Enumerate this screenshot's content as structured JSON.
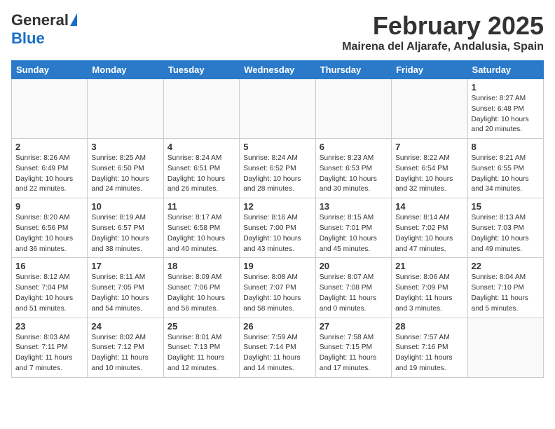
{
  "header": {
    "logo_general": "General",
    "logo_blue": "Blue",
    "month": "February 2025",
    "location": "Mairena del Aljarafe, Andalusia, Spain"
  },
  "weekdays": [
    "Sunday",
    "Monday",
    "Tuesday",
    "Wednesday",
    "Thursday",
    "Friday",
    "Saturday"
  ],
  "weeks": [
    [
      {
        "day": "",
        "info": ""
      },
      {
        "day": "",
        "info": ""
      },
      {
        "day": "",
        "info": ""
      },
      {
        "day": "",
        "info": ""
      },
      {
        "day": "",
        "info": ""
      },
      {
        "day": "",
        "info": ""
      },
      {
        "day": "1",
        "info": "Sunrise: 8:27 AM\nSunset: 6:48 PM\nDaylight: 10 hours\nand 20 minutes."
      }
    ],
    [
      {
        "day": "2",
        "info": "Sunrise: 8:26 AM\nSunset: 6:49 PM\nDaylight: 10 hours\nand 22 minutes."
      },
      {
        "day": "3",
        "info": "Sunrise: 8:25 AM\nSunset: 6:50 PM\nDaylight: 10 hours\nand 24 minutes."
      },
      {
        "day": "4",
        "info": "Sunrise: 8:24 AM\nSunset: 6:51 PM\nDaylight: 10 hours\nand 26 minutes."
      },
      {
        "day": "5",
        "info": "Sunrise: 8:24 AM\nSunset: 6:52 PM\nDaylight: 10 hours\nand 28 minutes."
      },
      {
        "day": "6",
        "info": "Sunrise: 8:23 AM\nSunset: 6:53 PM\nDaylight: 10 hours\nand 30 minutes."
      },
      {
        "day": "7",
        "info": "Sunrise: 8:22 AM\nSunset: 6:54 PM\nDaylight: 10 hours\nand 32 minutes."
      },
      {
        "day": "8",
        "info": "Sunrise: 8:21 AM\nSunset: 6:55 PM\nDaylight: 10 hours\nand 34 minutes."
      }
    ],
    [
      {
        "day": "9",
        "info": "Sunrise: 8:20 AM\nSunset: 6:56 PM\nDaylight: 10 hours\nand 36 minutes."
      },
      {
        "day": "10",
        "info": "Sunrise: 8:19 AM\nSunset: 6:57 PM\nDaylight: 10 hours\nand 38 minutes."
      },
      {
        "day": "11",
        "info": "Sunrise: 8:17 AM\nSunset: 6:58 PM\nDaylight: 10 hours\nand 40 minutes."
      },
      {
        "day": "12",
        "info": "Sunrise: 8:16 AM\nSunset: 7:00 PM\nDaylight: 10 hours\nand 43 minutes."
      },
      {
        "day": "13",
        "info": "Sunrise: 8:15 AM\nSunset: 7:01 PM\nDaylight: 10 hours\nand 45 minutes."
      },
      {
        "day": "14",
        "info": "Sunrise: 8:14 AM\nSunset: 7:02 PM\nDaylight: 10 hours\nand 47 minutes."
      },
      {
        "day": "15",
        "info": "Sunrise: 8:13 AM\nSunset: 7:03 PM\nDaylight: 10 hours\nand 49 minutes."
      }
    ],
    [
      {
        "day": "16",
        "info": "Sunrise: 8:12 AM\nSunset: 7:04 PM\nDaylight: 10 hours\nand 51 minutes."
      },
      {
        "day": "17",
        "info": "Sunrise: 8:11 AM\nSunset: 7:05 PM\nDaylight: 10 hours\nand 54 minutes."
      },
      {
        "day": "18",
        "info": "Sunrise: 8:09 AM\nSunset: 7:06 PM\nDaylight: 10 hours\nand 56 minutes."
      },
      {
        "day": "19",
        "info": "Sunrise: 8:08 AM\nSunset: 7:07 PM\nDaylight: 10 hours\nand 58 minutes."
      },
      {
        "day": "20",
        "info": "Sunrise: 8:07 AM\nSunset: 7:08 PM\nDaylight: 11 hours\nand 0 minutes."
      },
      {
        "day": "21",
        "info": "Sunrise: 8:06 AM\nSunset: 7:09 PM\nDaylight: 11 hours\nand 3 minutes."
      },
      {
        "day": "22",
        "info": "Sunrise: 8:04 AM\nSunset: 7:10 PM\nDaylight: 11 hours\nand 5 minutes."
      }
    ],
    [
      {
        "day": "23",
        "info": "Sunrise: 8:03 AM\nSunset: 7:11 PM\nDaylight: 11 hours\nand 7 minutes."
      },
      {
        "day": "24",
        "info": "Sunrise: 8:02 AM\nSunset: 7:12 PM\nDaylight: 11 hours\nand 10 minutes."
      },
      {
        "day": "25",
        "info": "Sunrise: 8:01 AM\nSunset: 7:13 PM\nDaylight: 11 hours\nand 12 minutes."
      },
      {
        "day": "26",
        "info": "Sunrise: 7:59 AM\nSunset: 7:14 PM\nDaylight: 11 hours\nand 14 minutes."
      },
      {
        "day": "27",
        "info": "Sunrise: 7:58 AM\nSunset: 7:15 PM\nDaylight: 11 hours\nand 17 minutes."
      },
      {
        "day": "28",
        "info": "Sunrise: 7:57 AM\nSunset: 7:16 PM\nDaylight: 11 hours\nand 19 minutes."
      },
      {
        "day": "",
        "info": ""
      }
    ]
  ]
}
